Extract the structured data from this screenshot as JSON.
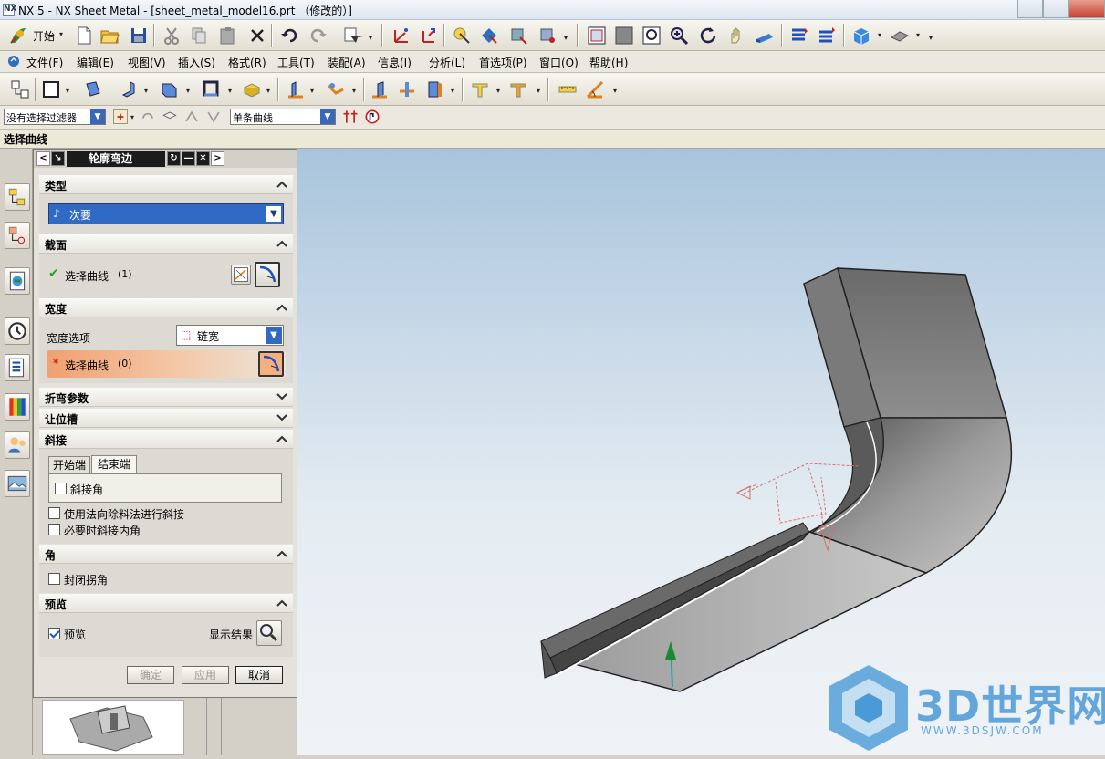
{
  "app": {
    "title": "NX 5 - NX Sheet Metal - [sheet_metal_model16.prt （修改的）]",
    "logo": "NX"
  },
  "toolbar": {
    "start_label": "开始"
  },
  "menu": {
    "items": [
      "文件(F)",
      "编辑(E)",
      "视图(V)",
      "插入(S)",
      "格式(R)",
      "工具(T)",
      "装配(A)",
      "信息(I)",
      "分析(L)",
      "首选项(P)",
      "窗口(O)",
      "帮助(H)"
    ]
  },
  "selection": {
    "filter_value": "没有选择过滤器",
    "curve_rule_value": "单条曲线"
  },
  "cue": {
    "text": "选择曲线"
  },
  "dialog": {
    "title": "轮廓弯边",
    "sections": {
      "type": {
        "header": "类型",
        "value": "次要"
      },
      "section": {
        "header": "截面",
        "select_curve": "选择曲线",
        "count": "(1)"
      },
      "width": {
        "header": "宽度",
        "option_label": "宽度选项",
        "option_value": "链宽",
        "select_curve": "选择曲线",
        "count": "(0)"
      },
      "bend_params": {
        "header": "折弯参数"
      },
      "relief": {
        "header": "让位槽"
      },
      "miter": {
        "header": "斜接",
        "tab_start": "开始端",
        "tab_end": "结束端",
        "miter_corner": "斜接角",
        "normal_removal": "使用法向除料法进行斜接",
        "miter_inner": "必要时斜接内角"
      },
      "corner": {
        "header": "角",
        "close_corner": "封闭拐角"
      },
      "preview": {
        "header": "预览",
        "preview_label": "预览",
        "preview_checked": true,
        "show_result": "显示结果"
      }
    },
    "buttons": {
      "ok": "确定",
      "apply": "应用",
      "cancel": "取消"
    }
  },
  "watermark": {
    "text": "3D世界网",
    "url": "WWW.3DSJW.COM"
  },
  "colors": {
    "accent": "#316ac5",
    "highlight_orange": "#f0b080",
    "viewport_top": "#a8c4dc"
  }
}
